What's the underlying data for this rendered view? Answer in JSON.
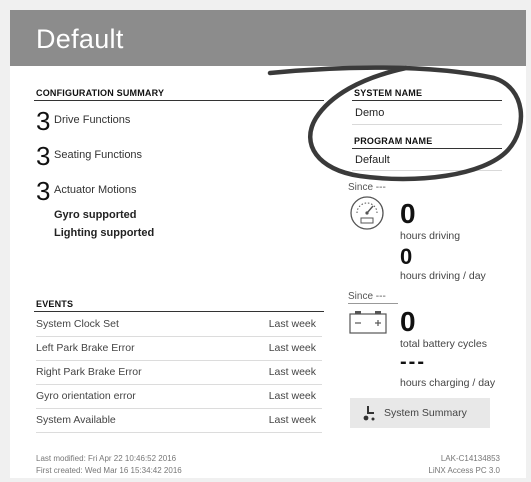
{
  "header": {
    "title": "Default"
  },
  "config": {
    "heading": "CONFIGURATION SUMMARY",
    "items": [
      {
        "count": "3",
        "label": "Drive Functions"
      },
      {
        "count": "3",
        "label": "Seating Functions"
      },
      {
        "count": "3",
        "label": "Actuator Motions"
      }
    ],
    "features": [
      "Gyro supported",
      "Lighting supported"
    ]
  },
  "system": {
    "system_name_label": "SYSTEM NAME",
    "system_name": "Demo",
    "program_name_label": "PROGRAM NAME",
    "program_name": "Default"
  },
  "stats": {
    "since_1": "Since ---",
    "hours_driving_value": "0",
    "hours_driving_label": "hours driving",
    "hours_per_day_value": "0",
    "hours_per_day_label": "hours driving / day",
    "since_2": "Since ---",
    "battery_value": "0",
    "battery_label": "total battery cycles",
    "charging_value": "---",
    "charging_label": "hours charging / day",
    "summary_button": "System Summary"
  },
  "events": {
    "heading": "EVENTS",
    "rows": [
      {
        "name": "System Clock Set",
        "when": "Last week"
      },
      {
        "name": "Left Park Brake Error",
        "when": "Last week"
      },
      {
        "name": "Right Park Brake Error",
        "when": "Last week"
      },
      {
        "name": "Gyro orientation error",
        "when": "Last week"
      },
      {
        "name": "System Available",
        "when": "Last week"
      }
    ]
  },
  "footer": {
    "last_modified": "Last modified: Fri Apr 22 10:46:52 2016",
    "first_created": "First created: Wed Mar 16 15:34:42 2016",
    "device_id": "LAK-C14134853",
    "app_version": "LiNX Access PC 3.0"
  }
}
